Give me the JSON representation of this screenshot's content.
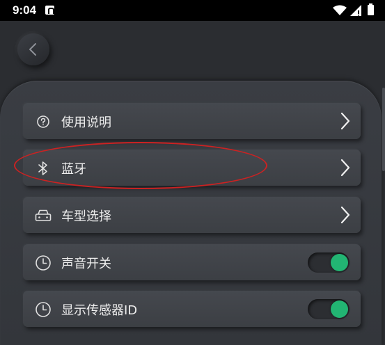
{
  "status_bar": {
    "time": "9:04",
    "notification_icon": "a-badge-icon",
    "wifi_icon": "wifi-icon",
    "signal_icon": "cell-signal-icon",
    "battery_icon": "battery-icon"
  },
  "header": {
    "back_icon": "chevron-left-icon"
  },
  "settings": {
    "items": [
      {
        "label": "使用说明",
        "icon": "help-circle-icon",
        "control": "chevron"
      },
      {
        "label": "蓝牙",
        "icon": "bluetooth-icon",
        "control": "chevron"
      },
      {
        "label": "车型选择",
        "icon": "car-icon",
        "control": "chevron"
      },
      {
        "label": "声音开关",
        "icon": "clock-icon",
        "control": "toggle",
        "toggle_on": true
      },
      {
        "label": "显示传感器ID",
        "icon": "clock-icon",
        "control": "toggle",
        "toggle_on": true
      }
    ]
  },
  "colors": {
    "background": "#2b2d31",
    "toggle_on": "#22b573",
    "highlight": "#cc2222"
  }
}
